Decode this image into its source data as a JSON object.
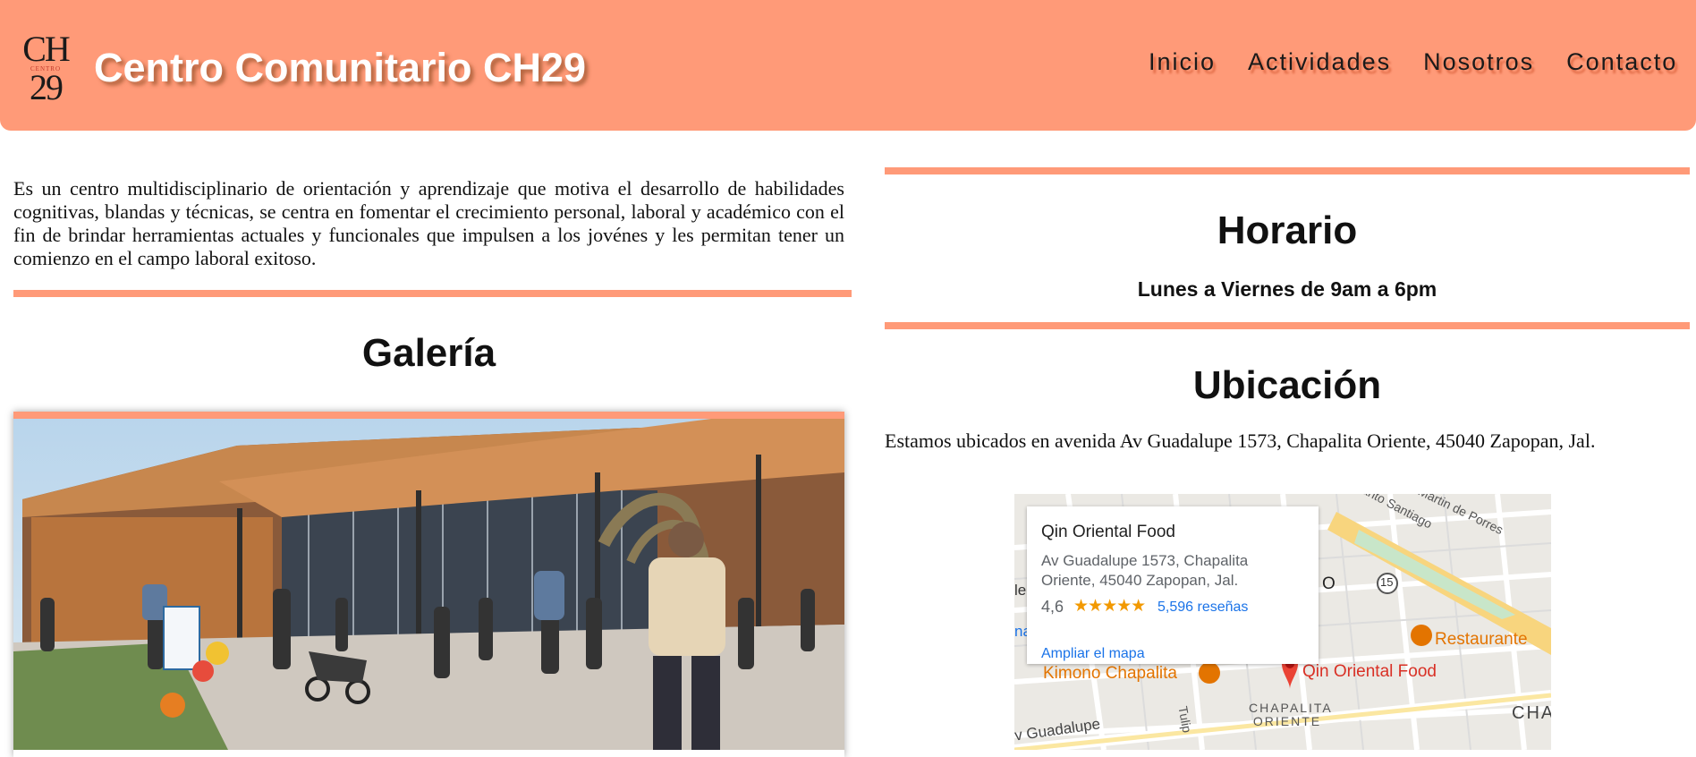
{
  "header": {
    "logo": {
      "top": "CH",
      "middle": "CENTRO",
      "bottom": "29"
    },
    "title": "Centro Comunitario CH29",
    "nav": [
      "Inicio",
      "Actividades",
      "Nosotros",
      "Contacto"
    ]
  },
  "intro": "Es un centro multidisciplinario de orientación y aprendizaje que motiva el desarrollo de habilidades cognitivas, blandas y técnicas, se centra en fomentar el crecimiento personal, laboral y académico con el fin de brindar herramientas actuales y funcionales que impulsen a los jovénes y les permitan tener un comienzo en el campo laboral exitoso.",
  "gallery": {
    "title": "Galería"
  },
  "schedule": {
    "title": "Horario",
    "hours": "Lunes a Viernes de 9am a 6pm"
  },
  "location": {
    "title": "Ubicación",
    "address": "Estamos ubicados en avenida Av Guadalupe 1573, Chapalita Oriente, 45040 Zapopan, Jal."
  },
  "map": {
    "card": {
      "name": "Qin Oriental Food",
      "address": "Av Guadalupe 1573, Chapalita Oriente, 45040 Zapopan, Jal.",
      "rating": "4,6",
      "stars": "★★★★★",
      "reviews": "5,596 reseñas",
      "expand": "Ampliar el mapa"
    },
    "pois": [
      "Kimono Chapalita",
      "Qin Oriental Food",
      "Restaurante"
    ],
    "labels": {
      "street_top": "San Martin de Porres",
      "street_top2": "Santo Santiago",
      "street_bottom": "v Guadalupe",
      "neighborhood": "CHAPALITA ORIENTE",
      "edge": "CHA",
      "route": "15",
      "o_label": "O",
      "na_label": "na",
      "le_label": "le",
      "tuli": "Tulip"
    },
    "colors": {
      "road": "#ffffff",
      "highway": "#f8d57e",
      "pin": "#ea4335",
      "food": "#f29900"
    }
  },
  "colors": {
    "accent": "#ff9a78"
  }
}
